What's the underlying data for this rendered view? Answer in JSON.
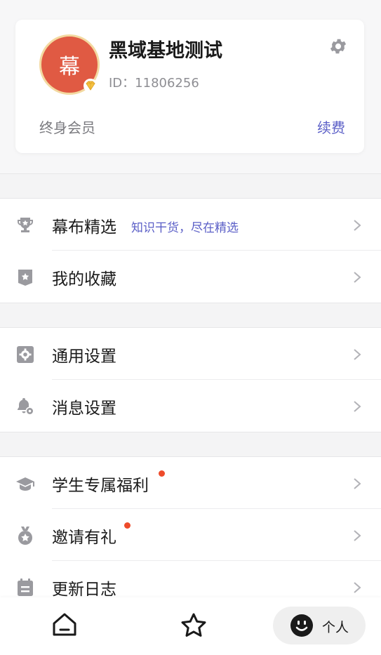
{
  "profile": {
    "avatar_text": "幕",
    "name": "黑域基地测试",
    "id_text": "ID：11806256",
    "membership": "终身会员",
    "renew_label": "续费"
  },
  "menu": {
    "featured": {
      "label": "幕布精选",
      "subtitle": "知识干货，尽在精选",
      "icon": "trophy-icon"
    },
    "favorites": {
      "label": "我的收藏",
      "icon": "star-badge-icon"
    },
    "general_settings": {
      "label": "通用设置",
      "icon": "gear-square-icon"
    },
    "message_settings": {
      "label": "消息设置",
      "icon": "bell-gear-icon"
    },
    "student_benefits": {
      "label": "学生专属福利",
      "icon": "graduation-cap-icon",
      "has_dot": true
    },
    "invite": {
      "label": "邀请有礼",
      "icon": "medal-icon",
      "has_dot": true
    },
    "changelog": {
      "label": "更新日志",
      "icon": "calendar-icon"
    }
  },
  "bottom_nav": {
    "home_icon": "home-icon",
    "favorites_icon": "star-outline-icon",
    "me_label": "个人",
    "me_icon": "smiley-face-icon"
  },
  "colors": {
    "accent": "#5b5fc7",
    "avatar_bg": "#e05a43",
    "notification_dot": "#ee4b2b",
    "icon_gray": "#9a9a9f"
  }
}
